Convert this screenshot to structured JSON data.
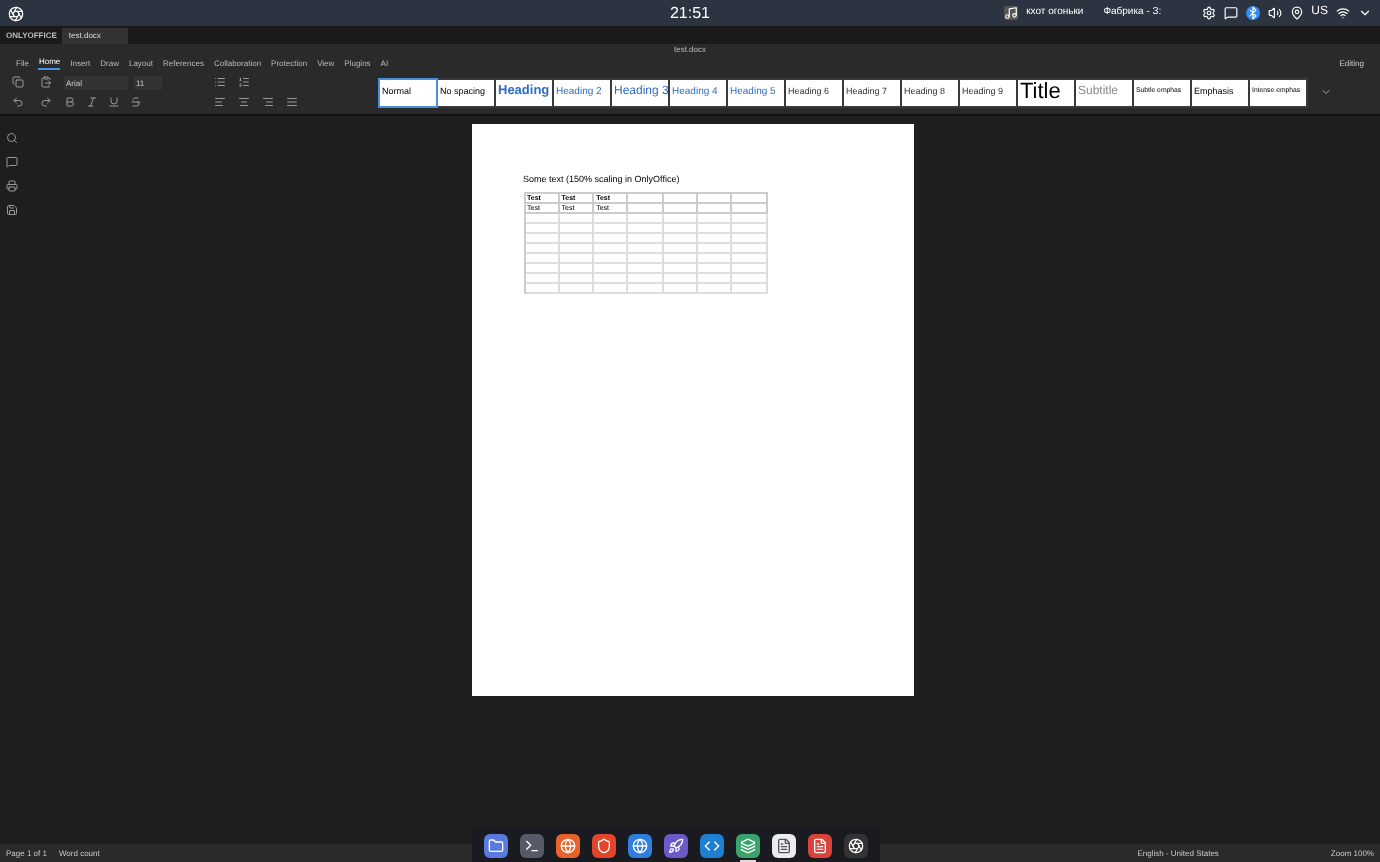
{
  "system_bar": {
    "time": "21:51",
    "media_title": "кхот огоньки",
    "media_artist": "Фабрика - З:",
    "keyboard": "US"
  },
  "app_tabs": [
    {
      "label": "ONLYOFFICE",
      "selected": false
    },
    {
      "label": "test.docx",
      "selected": true
    }
  ],
  "document_title": "test.docx",
  "menu_tabs": [
    {
      "label": "File",
      "selected": false
    },
    {
      "label": "Home",
      "selected": true
    },
    {
      "label": "Insert",
      "selected": false
    },
    {
      "label": "Draw",
      "selected": false
    },
    {
      "label": "Layout",
      "selected": false
    },
    {
      "label": "References",
      "selected": false
    },
    {
      "label": "Collaboration",
      "selected": false
    },
    {
      "label": "Protection",
      "selected": false
    },
    {
      "label": "View",
      "selected": false
    },
    {
      "label": "Plugins",
      "selected": false
    },
    {
      "label": "AI",
      "selected": false
    }
  ],
  "toolbar": {
    "font_name": "Arial",
    "font_size": "11",
    "mode": "Editing",
    "styles": [
      {
        "label": "Normal",
        "kind": "normal",
        "selected": true
      },
      {
        "label": "No spacing",
        "kind": "normal",
        "selected": false
      },
      {
        "label": "Heading",
        "kind": "h1",
        "selected": false
      },
      {
        "label": "Heading 2",
        "kind": "h2",
        "selected": false
      },
      {
        "label": "Heading 3",
        "kind": "h3",
        "selected": false
      },
      {
        "label": "Heading 4",
        "kind": "h4",
        "selected": false
      },
      {
        "label": "Heading 5",
        "kind": "h4",
        "selected": false
      },
      {
        "label": "Heading 6",
        "kind": "h6",
        "selected": false
      },
      {
        "label": "Heading 7",
        "kind": "h6",
        "selected": false
      },
      {
        "label": "Heading 8",
        "kind": "h6",
        "selected": false
      },
      {
        "label": "Heading 9",
        "kind": "h6",
        "selected": false
      },
      {
        "label": "Title",
        "kind": "title",
        "selected": false
      },
      {
        "label": "Subtitle",
        "kind": "subtitle",
        "selected": false
      },
      {
        "label": "Subtle emphas",
        "kind": "emphasis",
        "selected": false
      },
      {
        "label": "Emphasis",
        "kind": "normal",
        "selected": false
      },
      {
        "label": "Intense emphas",
        "kind": "emphasis",
        "selected": false
      }
    ]
  },
  "document": {
    "paragraph": "Some text (150% scaling in OnlyOffice)",
    "table_rows": [
      {
        "kind": "bold",
        "cells": [
          "Test",
          "Test",
          "Test"
        ]
      },
      {
        "kind": "plain",
        "cells": [
          "Test",
          "Test",
          "Test"
        ]
      }
    ]
  },
  "status_bar": {
    "page": "Page 1 of 1",
    "word_count": "Word count",
    "language": "English - United States",
    "zoom": "Zoom 100%"
  },
  "dock": [
    {
      "kind": "folder",
      "running": false
    },
    {
      "kind": "terminal",
      "running": false
    },
    {
      "kind": "firefox",
      "running": false
    },
    {
      "kind": "brave",
      "running": false
    },
    {
      "kind": "globe",
      "running": false
    },
    {
      "kind": "rocket",
      "running": false
    },
    {
      "kind": "code",
      "running": false
    },
    {
      "kind": "stack",
      "running": true
    },
    {
      "kind": "document",
      "running": false
    },
    {
      "kind": "red",
      "running": false
    },
    {
      "kind": "aperture",
      "running": false
    }
  ]
}
